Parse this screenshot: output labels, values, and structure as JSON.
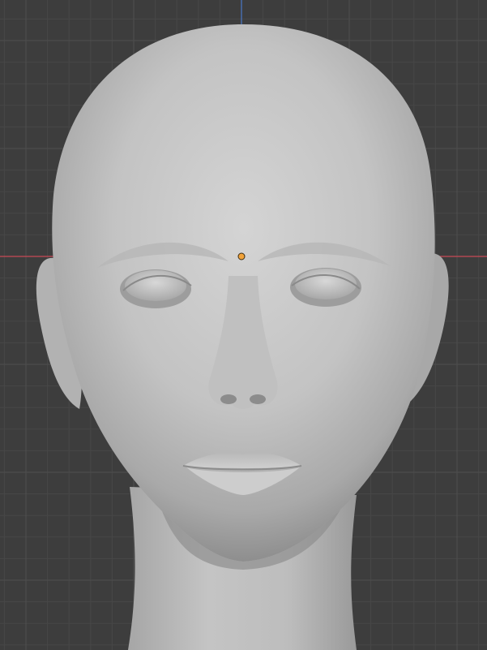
{
  "viewport": {
    "mode": "3d-viewport-front-orthographic",
    "background_color": "#3d3d3d",
    "grid_minor_color": "#474747",
    "grid_major_color": "#4f4f4f",
    "x_axis_color": "#c84a55",
    "z_axis_color": "#4a78c8",
    "origin_color": "#f2a33a"
  },
  "model": {
    "type": "sculpted-head",
    "material_color": "#c9c9c9"
  }
}
